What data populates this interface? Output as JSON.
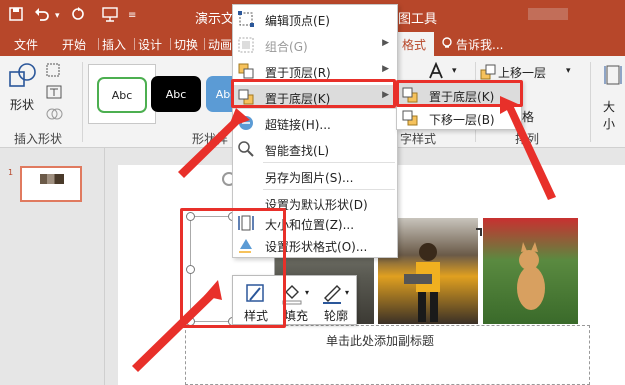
{
  "titlebar": {
    "doc_title": "演示文",
    "tools_title": "图工具"
  },
  "tabs": [
    {
      "label": "文件"
    },
    {
      "label": "开始"
    },
    {
      "label": "插入"
    },
    {
      "label": "设计"
    },
    {
      "label": "切换"
    },
    {
      "label": "动画"
    },
    {
      "label": "格式"
    },
    {
      "label": "告诉我..."
    }
  ],
  "ribbon": {
    "insert_shapes": {
      "shape_label": "形状",
      "group_label": "插入形状"
    },
    "shape_styles": {
      "swatches": [
        {
          "text": "Abc",
          "fill": "#ffffff",
          "border": "#4caf50",
          "text_color": "#222222"
        },
        {
          "text": "Abc",
          "fill": "#000000",
          "border": "#000000",
          "text_color": "#ffffff"
        },
        {
          "text": "Abc",
          "fill": "#5b9bd5",
          "border": "#5b9bd5",
          "text_color": "#ffffff"
        }
      ],
      "group_label_partial": "形状样"
    },
    "wordart_group_label": "字样式",
    "arrange": {
      "bring_forward": "上移一层",
      "send_backward": "下移一层",
      "align": "格",
      "group_label": "排列"
    },
    "size_label": "大小"
  },
  "context_menu": {
    "items": [
      {
        "label": "编辑顶点",
        "shortcut": "(E)",
        "icon": "edit-points-icon",
        "disabled": false,
        "submenu": false
      },
      {
        "label": "组合",
        "shortcut": "(G)",
        "icon": "group-icon",
        "disabled": true,
        "submenu": true
      },
      {
        "label": "置于顶层",
        "shortcut": "(R)",
        "icon": "bring-to-front-icon",
        "disabled": false,
        "submenu": true
      },
      {
        "label": "置于底层",
        "shortcut": "(K)",
        "icon": "send-to-back-icon",
        "disabled": false,
        "submenu": true,
        "highlighted": true
      },
      {
        "label": "超链接",
        "shortcut": "(H)...",
        "icon": "hyperlink-icon",
        "disabled": false,
        "submenu": false
      },
      {
        "label": "智能查找",
        "shortcut": "(L)",
        "icon": "smart-lookup-icon",
        "disabled": false,
        "submenu": false
      },
      {
        "label": "另存为图片",
        "shortcut": "(S)...",
        "icon": "",
        "disabled": false,
        "submenu": false
      },
      {
        "label": "设置为默认形状",
        "shortcut": "(D)",
        "icon": "",
        "disabled": false,
        "submenu": false
      },
      {
        "label": "大小和位置",
        "shortcut": "(Z)...",
        "icon": "size-position-icon",
        "disabled": false,
        "submenu": false
      },
      {
        "label": "设置形状格式",
        "shortcut": "(O)...",
        "icon": "format-shape-icon",
        "disabled": false,
        "submenu": false
      }
    ]
  },
  "submenu": {
    "items": [
      {
        "label": "置于底层",
        "shortcut": "(K)",
        "highlighted": true
      },
      {
        "label": "下移一层",
        "shortcut": "(B)",
        "highlighted": false
      }
    ]
  },
  "mini_toolbar": {
    "style_label": "样式",
    "fill_label": "填充",
    "outline_label": "轮廓"
  },
  "slide": {
    "subtitle_placeholder": "单击此处添加副标题",
    "thumbnail_number": "1"
  },
  "colors": {
    "accent": "#b7472a",
    "annotation_red": "#e8302a"
  }
}
